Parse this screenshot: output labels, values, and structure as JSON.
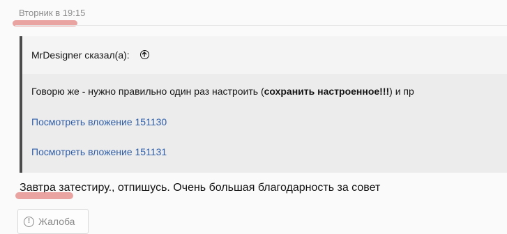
{
  "post": {
    "date": "Вторник в 19:15",
    "quote": {
      "author_said": "MrDesigner сказал(а):",
      "text_before": "Говорю же - нужно правильно один раз настроить (",
      "text_bold": "сохранить настроенное!!!",
      "text_after": ") и пр",
      "attachments": [
        "Посмотреть вложение 151130",
        "Посмотреть вложение 151131"
      ]
    },
    "message": "Завтра затестиру., отпишусь. Очень большая благодарность за совет",
    "report_label": "Жалоба"
  },
  "colors": {
    "link": "#2f5ea8",
    "highlight": "#e79a98",
    "quote_border": "#4b4b4b"
  },
  "icons": {
    "quote_jump": "arrow-up-circle-icon",
    "report": "exclamation-circle-icon"
  }
}
